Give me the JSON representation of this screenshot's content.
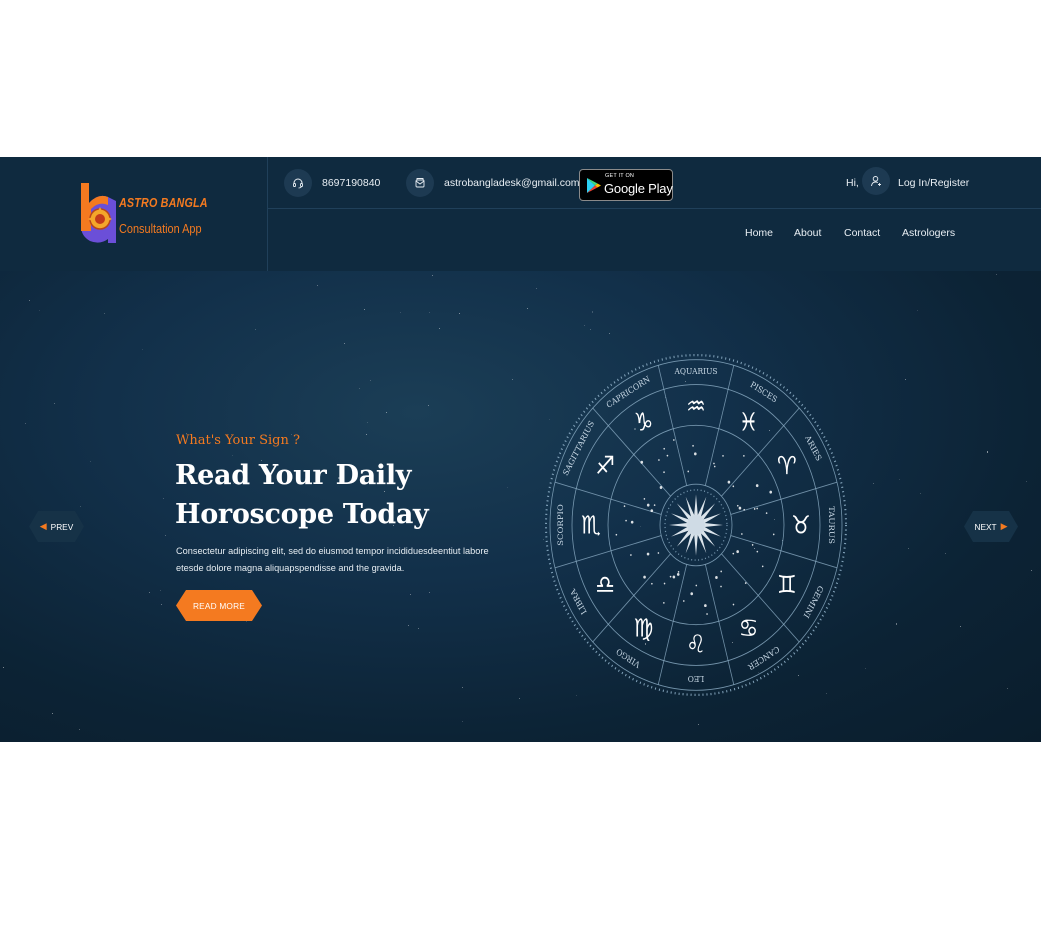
{
  "brand": {
    "logo_line1": "ASTRO BANGLA",
    "logo_line2": "Consultation App"
  },
  "topbar": {
    "phone": "8697190840",
    "email": "astrobangladesk@gmail.com",
    "google_play": {
      "small": "GET IT ON",
      "big": "Google Play"
    },
    "greeting": "Hi,",
    "login": "Log In/Register"
  },
  "nav": {
    "items": [
      {
        "label": "Home"
      },
      {
        "label": "About"
      },
      {
        "label": "Contact"
      },
      {
        "label": "Astrologers"
      }
    ]
  },
  "hero": {
    "eyebrow": "What's Your Sign ?",
    "headline_line1": "Read Your Daily",
    "headline_line2": "Horoscope Today",
    "paragraph_line1": "Consectetur adipiscing elit, sed do eiusmod tempor incididuesdeentiut labore",
    "paragraph_line2": "etesde dolore magna aliquapspendisse and the gravida.",
    "cta": "READ MORE",
    "prev": "PREV",
    "next": "NEXT"
  },
  "zodiac": {
    "signs": [
      "PISCES",
      "ARIES",
      "TAURUS",
      "GEMINI",
      "CANCER",
      "LEO",
      "VIRGO",
      "LIBRA",
      "SCORPIO",
      "SAGITTARIUS",
      "CAPRICORN",
      "AQUARIUS"
    ],
    "symbols": [
      "♓",
      "♈",
      "♉",
      "♊",
      "♋",
      "♌",
      "♍",
      "♎",
      "♏",
      "♐",
      "♑",
      "♒"
    ]
  },
  "colors": {
    "accent": "#f47a20",
    "header_bg": "#0f2a3f",
    "hero_bg": "#12304a",
    "wheel_line": "#8fb0c8"
  }
}
